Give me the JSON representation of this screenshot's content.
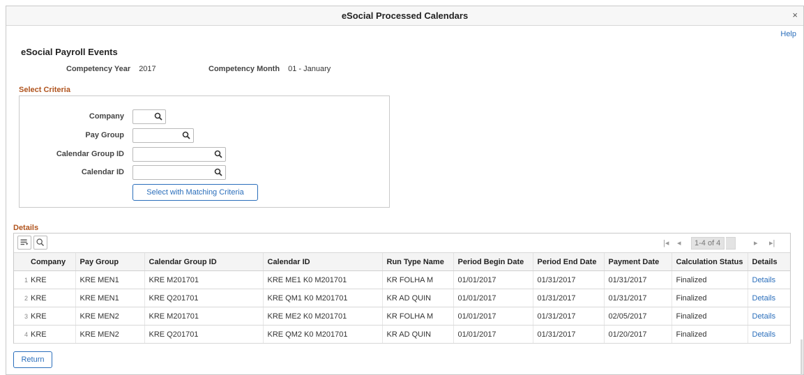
{
  "window": {
    "title": "eSocial Processed Calendars",
    "close_label": "×",
    "help_label": "Help"
  },
  "page": {
    "heading": "eSocial Payroll Events",
    "competency_year_label": "Competency Year",
    "competency_year": "2017",
    "competency_month_label": "Competency Month",
    "competency_month": "01 - January"
  },
  "criteria": {
    "section_title": "Select Criteria",
    "company_label": "Company",
    "company_value": "",
    "pay_group_label": "Pay Group",
    "pay_group_value": "",
    "calendar_group_label": "Calendar Group ID",
    "calendar_group_value": "",
    "calendar_id_label": "Calendar ID",
    "calendar_id_value": "",
    "select_button": "Select with Matching Criteria"
  },
  "details": {
    "section_title": "Details",
    "pager": {
      "range": "1-4 of 4",
      "first": "|◂",
      "prev": "◂",
      "next": "▸",
      "last": "▸|"
    },
    "columns": [
      "Company",
      "Pay Group",
      "Calendar Group ID",
      "Calendar ID",
      "Run Type Name",
      "Period Begin Date",
      "Period End Date",
      "Payment Date",
      "Calculation Status",
      "Details"
    ],
    "rows": [
      {
        "num": "1",
        "company": "KRE",
        "pay_group": "KRE MEN1",
        "cal_group": "KRE M201701",
        "cal_id": "KRE ME1 K0 M201701",
        "run_type": "KR FOLHA M",
        "begin": "01/01/2017",
        "end": "01/31/2017",
        "payment": "01/31/2017",
        "status": "Finalized",
        "details": "Details"
      },
      {
        "num": "2",
        "company": "KRE",
        "pay_group": "KRE MEN1",
        "cal_group": "KRE Q201701",
        "cal_id": "KRE QM1 K0 M201701",
        "run_type": "KR AD QUIN",
        "begin": "01/01/2017",
        "end": "01/31/2017",
        "payment": "01/31/2017",
        "status": "Finalized",
        "details": "Details"
      },
      {
        "num": "3",
        "company": "KRE",
        "pay_group": "KRE MEN2",
        "cal_group": "KRE M201701",
        "cal_id": "KRE ME2 K0 M201701",
        "run_type": "KR FOLHA M",
        "begin": "01/01/2017",
        "end": "01/31/2017",
        "payment": "02/05/2017",
        "status": "Finalized",
        "details": "Details"
      },
      {
        "num": "4",
        "company": "KRE",
        "pay_group": "KRE MEN2",
        "cal_group": "KRE Q201701",
        "cal_id": "KRE QM2 K0 M201701",
        "run_type": "KR AD QUIN",
        "begin": "01/01/2017",
        "end": "01/31/2017",
        "payment": "01/20/2017",
        "status": "Finalized",
        "details": "Details"
      }
    ]
  },
  "footer": {
    "return_button": "Return"
  },
  "colors": {
    "link": "#2a6ebb",
    "section_title": "#b0541e"
  }
}
